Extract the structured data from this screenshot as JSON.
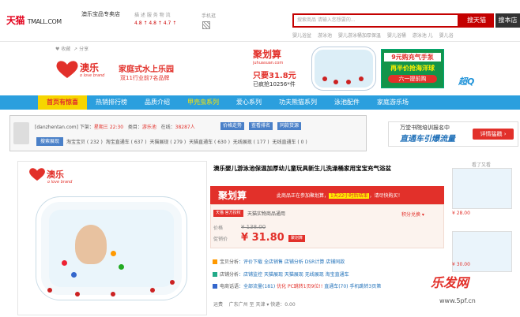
{
  "header": {
    "logo": "天猫",
    "logo_suffix": "TMALL.COM",
    "shop_name": "澳乐宝品专卖店",
    "dsr_labels": "描 述 服 务 物 流",
    "dsr_values": "4.8 ↑ 4.8 ↑ 4.7 ↑",
    "mobile_label": "手机逛",
    "search_placeholder": "搜索商品 请输入您想要的...",
    "search_button": "搜天猫",
    "search_store_button": "搜本店",
    "hot_words": [
      "婴儿浴盆",
      "游泳池",
      "婴儿游泳桶加厚保温",
      "婴儿浴桶",
      "游泳池 儿",
      "婴儿浴"
    ],
    "favorite": "收藏",
    "share": "分享"
  },
  "brand_banner": {
    "brand_name": "澳乐",
    "brand_slogan": "o love brand",
    "title": "家庭式水上乐园",
    "subtitle": "双11行业前7名品牌",
    "ju_title": "聚划算",
    "ju_site": "juhuasuan.com",
    "ju_price": "只要31.8元",
    "ju_sold": "已疯抢10256*件",
    "promo_line1": "9元购充气手泵",
    "promo_line2": "再半价抢海洋球",
    "promo_line3": "六一提前购",
    "superq": "超Q"
  },
  "nav": {
    "items": [
      "首页有惊喜",
      "热销排行榜",
      "品质介绍",
      "甲壳虫系列",
      "爱心系列",
      "功夫熊猫系列",
      "泳池配件",
      "家庭游乐场"
    ]
  },
  "plugin": {
    "site": "[danzhentan.com]",
    "shelf_label": "下架：",
    "shelf_value": "星期三 22:30",
    "category_label": "类目：",
    "category_value": "游乐池",
    "online_label": "在线：",
    "online_value": "38287人",
    "buttons": [
      "价格走势",
      "查看排名",
      "同款货源"
    ],
    "rank_button": "搜索展现",
    "ranks": [
      "淘宝宝贝 ( 232 )",
      "淘宝直通车 ( 637 )",
      "天猫展现 ( 279 )",
      "天猫直通车 ( 630 )",
      "无线展现 ( 177 )",
      "无线直通车 ( 0 )"
    ]
  },
  "ad_right": {
    "line1": "万堂书院培训报名中",
    "line2": "直通车引爆流量",
    "button": "详情猛戳 ›"
  },
  "product": {
    "brand_name": "澳乐",
    "brand_slogan": "o love brand",
    "title": "澳乐婴儿游泳池保温加厚幼儿童玩具新生儿洗澡桶家用宝宝充气浴盆",
    "ju_label": "聚划算",
    "ju_notice": "此商品正在参加聚划算，",
    "ju_highlight": "1天22小时后结束",
    "ju_notice_end": "，请尽快购买！",
    "tmall_badge": "天猫 官方授权",
    "auth_text": "天猫实物商品通用",
    "points": "积分兑换 ▾",
    "price_label": "价格",
    "price_old": "¥ 138.00",
    "promo_label": "促销价",
    "price_new": "¥ 31.80",
    "price_tag": "聚划算",
    "stock_label": "宝贝分析",
    "stock_items": "评价下载  全店销售  店铺分析  DSR计算  店铺同款",
    "shop_analysis_label": "店铺分析",
    "shop_analysis_items": "店铺监控  天猫展现  天猫展现  无线展现  淘宝直通车",
    "keyword_label": "电商话语",
    "keyword_text": "全部流量(181)",
    "keyword_mid": "优化 PC跳转1页9位!!",
    "keyword_end": "直通车(70) 手机跳转3页第",
    "ship_label": "运费",
    "ship_text": "广东广州 至 天津 ▾ 快递：0.00"
  },
  "sidebar": {
    "title": "看了又看",
    "prices": [
      "¥ 28.00",
      "¥ 30.00"
    ]
  },
  "watermark": {
    "brand": "乐发网",
    "url": "www.5pf.cn"
  }
}
